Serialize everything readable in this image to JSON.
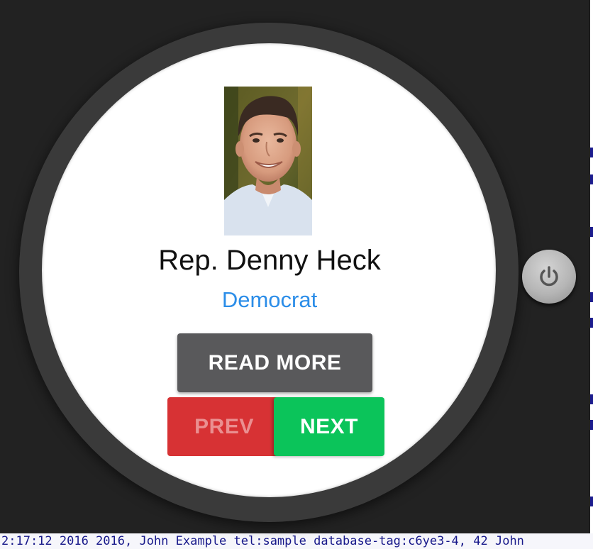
{
  "watch": {
    "representative": {
      "name": "Rep. Denny Heck",
      "party": "Democrat",
      "party_color": "#2b8de8"
    },
    "buttons": {
      "read_more": "READ MORE",
      "prev": "PREV",
      "next": "NEXT"
    },
    "colors": {
      "read_more_bg": "#59595b",
      "prev_bg": "#d73234",
      "next_bg": "#0bc45a"
    },
    "power_icon": "power-icon"
  },
  "background": {
    "partial_text": "2:17:12 2016 2016, John Example tel:sample database-tag:c6ye3-4, 42 John"
  }
}
